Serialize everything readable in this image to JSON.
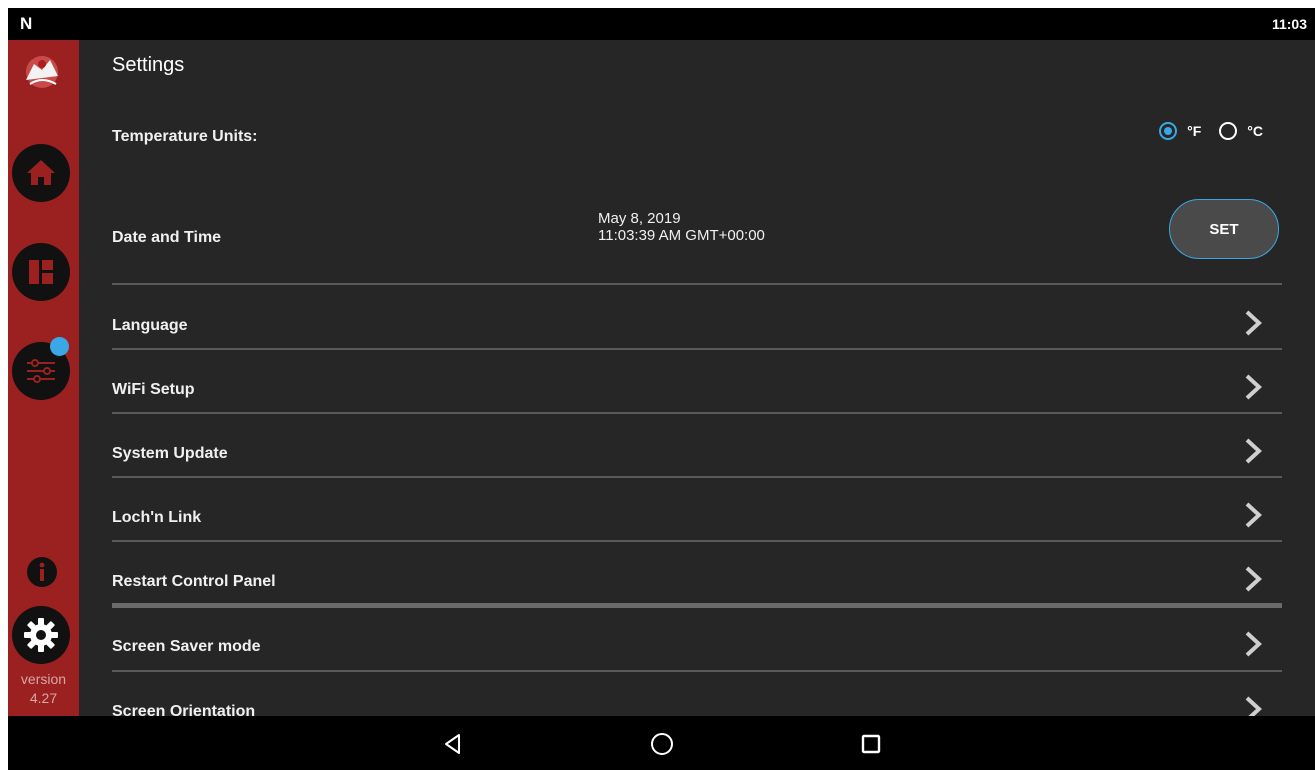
{
  "status_bar": {
    "logo": "N",
    "time": "11:03"
  },
  "sidebar": {
    "items": [
      {
        "name": "home-icon"
      },
      {
        "name": "dashboard-icon"
      },
      {
        "name": "sliders-icon"
      },
      {
        "name": "info-icon"
      },
      {
        "name": "gear-icon"
      }
    ],
    "version_label": "version",
    "version_number": "4.27",
    "accent_color": "#9b2020",
    "badge_color": "#3aa7e6"
  },
  "header": {
    "title": "Settings"
  },
  "temperature": {
    "label": "Temperature Units:",
    "options": [
      {
        "label": "°F",
        "selected": true
      },
      {
        "label": "°C",
        "selected": false
      }
    ]
  },
  "date_time": {
    "label": "Date and Time",
    "date": "May 8, 2019",
    "time": "11:03:39 AM GMT+00:00",
    "button_label": "SET"
  },
  "menu_rows": [
    {
      "label": "Language"
    },
    {
      "label": "WiFi Setup"
    },
    {
      "label": "System Update"
    },
    {
      "label": "Loch'n Link"
    },
    {
      "label": "Restart Control Panel"
    },
    {
      "label": "Screen Saver mode"
    },
    {
      "label": "Screen Orientation"
    }
  ],
  "nav_bar": {
    "items": [
      {
        "name": "back-icon"
      },
      {
        "name": "home-circle-icon"
      },
      {
        "name": "recents-icon"
      }
    ]
  }
}
